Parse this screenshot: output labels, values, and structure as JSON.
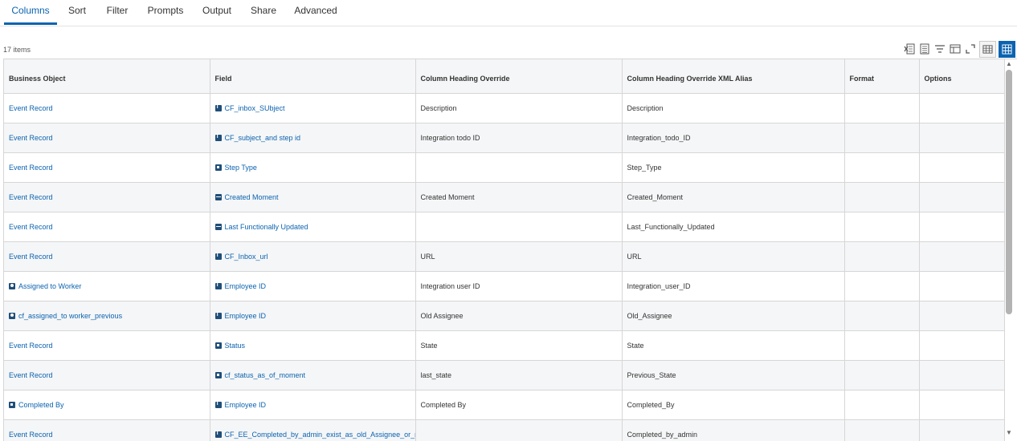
{
  "tabs": [
    {
      "label": "Columns",
      "active": true
    },
    {
      "label": "Sort"
    },
    {
      "label": "Filter"
    },
    {
      "label": "Prompts"
    },
    {
      "label": "Output"
    },
    {
      "label": "Share"
    },
    {
      "label": "Advanced"
    }
  ],
  "grid": {
    "count_label": "17 items",
    "headers": [
      "Business Object",
      "Field",
      "Column Heading Override",
      "Column Heading Override XML Alias",
      "Format",
      "Options"
    ],
    "rows": [
      {
        "bo": "Event Record",
        "bo_icon": "",
        "field": "CF_inbox_SUbject",
        "field_icon": "text-field-icon",
        "override": "Description",
        "alias": "Description"
      },
      {
        "bo": "Event Record",
        "bo_icon": "",
        "field": "CF_subject_and step id",
        "field_icon": "text-field-icon",
        "override": "Integration todo ID",
        "alias": "Integration_todo_ID"
      },
      {
        "bo": "Event Record",
        "bo_icon": "",
        "field": "Step Type",
        "field_icon": "single-instance-icon",
        "override": "",
        "alias": "Step_Type"
      },
      {
        "bo": "Event Record",
        "bo_icon": "",
        "field": "Created Moment",
        "field_icon": "date-field-icon",
        "override": "Created Moment",
        "alias": "Created_Moment"
      },
      {
        "bo": "Event Record",
        "bo_icon": "",
        "field": "Last Functionally Updated",
        "field_icon": "date-field-icon",
        "override": "",
        "alias": "Last_Functionally_Updated"
      },
      {
        "bo": "Event Record",
        "bo_icon": "",
        "field": "CF_Inbox_url",
        "field_icon": "text-field-icon",
        "override": "URL",
        "alias": "URL"
      },
      {
        "bo": "Assigned to Worker",
        "bo_icon": "worker-icon",
        "field": "Employee ID",
        "field_icon": "text-field-icon",
        "override": "Integration user ID",
        "alias": "Integration_user_ID"
      },
      {
        "bo": "cf_assigned_to worker_previous",
        "bo_icon": "worker-icon",
        "field": "Employee ID",
        "field_icon": "text-field-icon",
        "override": "Old Assignee",
        "alias": "Old_Assignee"
      },
      {
        "bo": "Event Record",
        "bo_icon": "",
        "field": "Status",
        "field_icon": "single-instance-icon",
        "override": "State",
        "alias": "State"
      },
      {
        "bo": "Event Record",
        "bo_icon": "",
        "field": "cf_status_as_of_moment",
        "field_icon": "single-instance-icon",
        "override": "last_state",
        "alias": "Previous_State"
      },
      {
        "bo": "Completed By",
        "bo_icon": "single-instance-icon",
        "field": "Employee ID",
        "field_icon": "text-field-icon",
        "override": "Completed By",
        "alias": "Completed_By"
      },
      {
        "bo": "Event Record",
        "bo_icon": "",
        "field": "CF_EE_Completed_by_admin_exist_as_old_Assignee_or_n",
        "field_icon": "text-field-icon",
        "override": "",
        "alias": "Completed_by_admin"
      }
    ]
  },
  "toolbar_icons": [
    "export-excel-icon",
    "export-pdf-icon",
    "filter-icon",
    "columns-icon",
    "fullscreen-icon",
    "table-view-icon",
    "grid-view-icon"
  ],
  "colors": {
    "accent": "#0b63b0",
    "header_bg": "#f5f6f7",
    "border": "#d6d6d6"
  }
}
